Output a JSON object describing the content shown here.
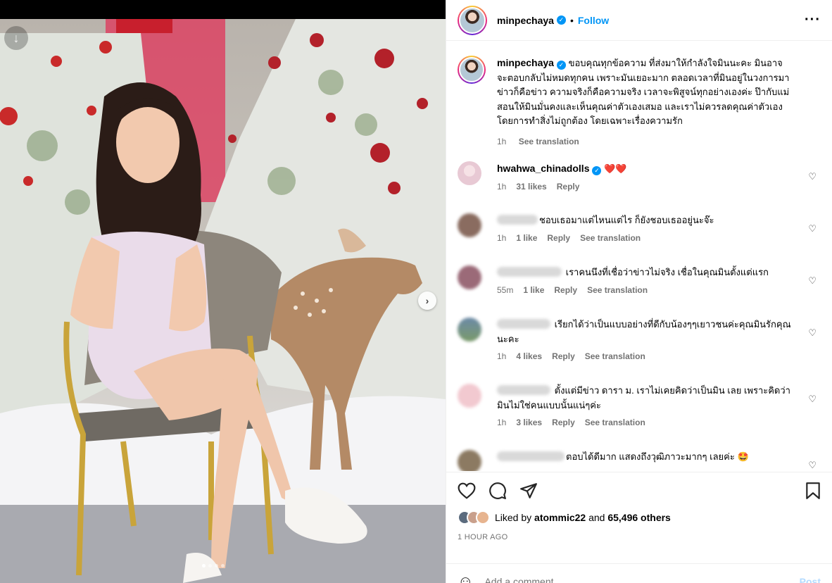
{
  "post": {
    "username": "minpechaya",
    "follow_label": "Follow",
    "caption": "ขอบคุณทุกข้อความ ที่ส่งมาให้กำลังใจมินนะคะ มินอาจจะตอบกลับไม่หมดทุกคน เพราะมันเยอะมาก ตลอดเวลาที่มินอยู่ในวงการมา ข่าวก็คือข่าว ความจริงก็คือความจริง เวลาจะพิสูจน์ทุกอย่างเองค่ะ ป๊ากับแม่สอนให้มินมั่นคงและเห็นคุณค่าตัวเองเสมอ และเราไม่ควรลดคุณค่าตัวเอง โดยการทำสิ่งไม่ถูกต้อง โดยเฉพาะเรื่องความรัก",
    "caption_time": "1h",
    "see_translation": "See translation"
  },
  "comments": [
    {
      "user": "hwahwa_chinadolls",
      "text": "❤️❤️",
      "time": "1h",
      "likes": "31 likes",
      "reply": "Reply",
      "translate": "",
      "avatar": "#e8c9d4"
    },
    {
      "user": "",
      "text": "ชอบเธอมาแต่ไหนแต่ไร ก็ยังชอบเธออยู่นะจ๊ะ",
      "time": "1h",
      "likes": "1 like",
      "reply": "Reply",
      "translate": "See translation",
      "avatar": "#8a6c60"
    },
    {
      "user": "",
      "text": "เราคนนึงที่เชื่อว่าข่าวไม่จริง เชื่อในคุณมินตั้งแต่แรก",
      "time": "55m",
      "likes": "1 like",
      "reply": "Reply",
      "translate": "See translation",
      "avatar": "#9b6a78"
    },
    {
      "user": "",
      "text": "เรียกได้ว่าเป็นแบบอย่างที่ดีกับน้องๆๆเยาวชนค่ะคุณมินรักคุณนะคะ",
      "time": "1h",
      "likes": "4 likes",
      "reply": "Reply",
      "translate": "See translation",
      "avatar": "#6c8aa8"
    },
    {
      "user": "",
      "text": "ตั้งแต่มีข่าว ดารา ม. เราไม่เคยคิดว่าเป็นมิน เลย เพราะคิดว่ามินไม่ใช่คนแบบนั้นแน่ๆค่ะ",
      "time": "1h",
      "likes": "3 likes",
      "reply": "Reply",
      "translate": "See translation",
      "avatar": "#f2c9d0"
    },
    {
      "user": "",
      "text": "ตอบได้ดีมาก แสดงถึงวุฒิภาวะมากๆ เลยค่ะ 🤩",
      "time": "",
      "likes": "",
      "reply": "",
      "translate": "",
      "avatar": "#8c7a62"
    }
  ],
  "footer": {
    "liked_by_prefix": "Liked by",
    "liked_by_user": "atommic22",
    "liked_by_and": "and",
    "others": "65,496 others",
    "time_ago": "1 HOUR AGO",
    "add_comment_placeholder": "Add a comment...",
    "post_label": "Post"
  },
  "icons": [
    "download-icon",
    "next-arrow-icon",
    "more-icon",
    "heart-icon",
    "comment-icon",
    "share-icon",
    "bookmark-icon",
    "emoji-icon",
    "verified-icon"
  ],
  "colors": {
    "accent": "#0095f6",
    "muted": "#737373"
  }
}
